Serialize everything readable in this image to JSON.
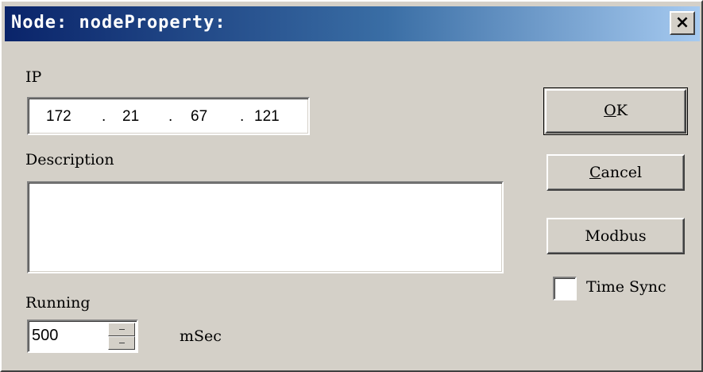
{
  "window": {
    "title": "Node: nodeProperty:",
    "close_glyph": "×"
  },
  "ip": {
    "label": "IP",
    "octets": [
      "172",
      "21",
      "67",
      "121"
    ],
    "separator": "."
  },
  "description": {
    "label": "Description",
    "value": ""
  },
  "running": {
    "label": "Running",
    "value": "500",
    "unit": "mSec"
  },
  "buttons": {
    "ok": {
      "mnemonic": "O",
      "rest": "K"
    },
    "cancel": {
      "mnemonic": "C",
      "rest": "ancel"
    },
    "modbus": {
      "label": "Modbus"
    }
  },
  "time_sync": {
    "label": "Time Sync",
    "checked": false
  },
  "colors": {
    "title_gradient_start": "#0a246a",
    "title_gradient_end": "#a6caf0",
    "face": "#d4d0c8"
  }
}
